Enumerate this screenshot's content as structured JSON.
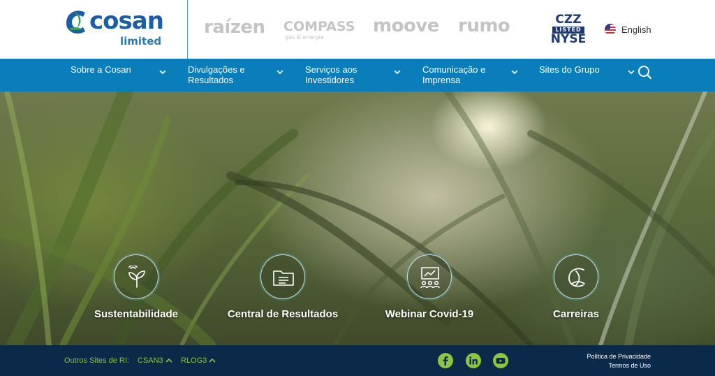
{
  "header": {
    "logo": {
      "word": "cosan",
      "sub": "limited"
    },
    "brands": [
      {
        "name": "raízen"
      },
      {
        "name": "COMPASS",
        "sub": "gás & energia"
      },
      {
        "name": "moove"
      },
      {
        "name": "rumo"
      }
    ],
    "nyse": {
      "ticker": "CZZ",
      "listed": "LISTED",
      "exchange": "NYSE"
    },
    "language": "English"
  },
  "nav": {
    "items": [
      {
        "label": "Sobre a Cosan"
      },
      {
        "label": "Divulgações e Resultados"
      },
      {
        "label": "Serviços aos Investidores"
      },
      {
        "label": "Comunicação e Imprensa"
      },
      {
        "label": "Sites do Grupo"
      }
    ]
  },
  "hero": {
    "tiles": [
      {
        "label": "Sustentabilidade",
        "icon": "plant-icon"
      },
      {
        "label": "Central de Resultados",
        "icon": "folder-icon"
      },
      {
        "label": "Webinar Covid-19",
        "icon": "presentation-icon"
      },
      {
        "label": "Carreiras",
        "icon": "leaf-logo-icon"
      }
    ]
  },
  "footer": {
    "outros_label": "Outros Sites de RI:",
    "links": [
      {
        "label": "CSAN3"
      },
      {
        "label": "RLOG3"
      }
    ],
    "social": [
      "facebook-icon",
      "linkedin-icon",
      "youtube-icon"
    ],
    "legal": {
      "privacy": "Política de Privacidade",
      "terms": "Termos de Uso"
    }
  },
  "colors": {
    "brand_blue": "#1a5fa6",
    "nav_blue": "#0a7dbb",
    "footer_navy": "#0b2a4a",
    "accent_green": "#8cc63f"
  }
}
